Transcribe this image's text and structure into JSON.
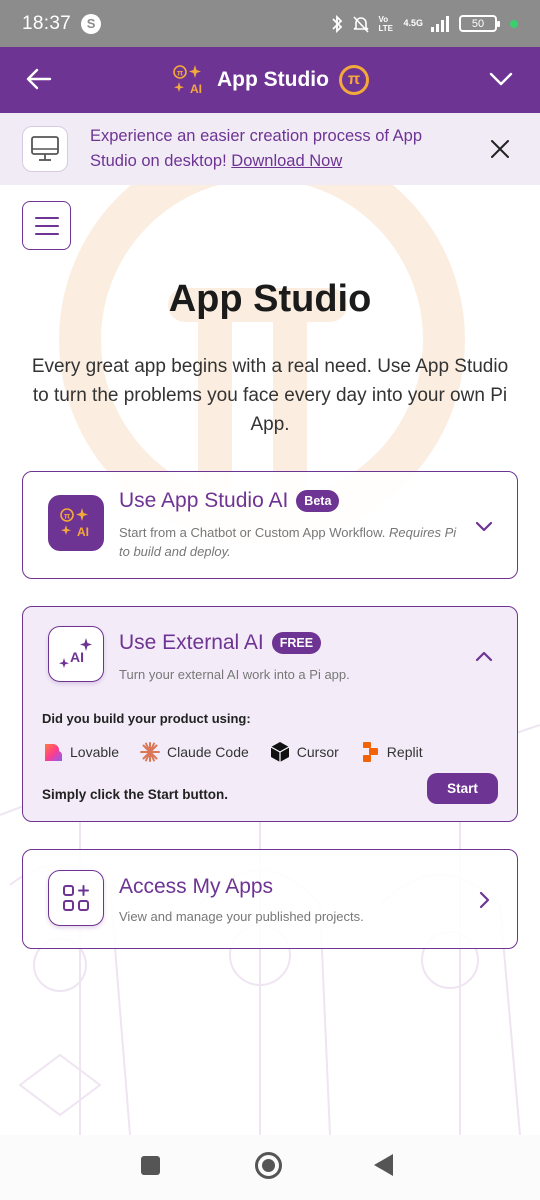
{
  "status_bar": {
    "time": "18:37",
    "app_badge": "S",
    "network": "4.5G",
    "volte": "Vo LTE",
    "battery": "50"
  },
  "app_bar": {
    "title": "App Studio",
    "logo_text": "AI",
    "pi_symbol": "π"
  },
  "banner": {
    "text": "Experience an easier creation process of App Studio on desktop!",
    "link": "Download Now"
  },
  "page": {
    "title": "App Studio",
    "description": "Every great app begins with a real need. Use App Studio to turn the problems you face every day into your own Pi App."
  },
  "cards": {
    "studio_ai": {
      "title": "Use App Studio AI",
      "badge": "Beta",
      "subtitle": "Start from a Chatbot or Custom App Workflow.",
      "subtitle_note": "Requires Pi to build and deploy.",
      "icon_text": "AI"
    },
    "external_ai": {
      "title": "Use External AI",
      "badge": "FREE",
      "subtitle": "Turn your external AI work into a Pi app.",
      "icon_text": "AI",
      "question": "Did you build your product using:",
      "tools": [
        "Lovable",
        "Claude Code",
        "Cursor",
        "Replit"
      ],
      "instruction": "Simply click the Start button.",
      "start_label": "Start"
    },
    "my_apps": {
      "title": "Access My Apps",
      "subtitle": "View and manage your published projects."
    }
  },
  "colors": {
    "primary": "#6e3493",
    "accent": "#f4a93a",
    "banner_bg": "#f1ebf6"
  },
  "icons": [
    "back-arrow-icon",
    "chevron-down-icon",
    "desktop-icon",
    "close-icon",
    "menu-icon",
    "sparkle-ai-icon",
    "apps-grid-icon",
    "chevron-right-icon",
    "chevron-up-icon"
  ]
}
